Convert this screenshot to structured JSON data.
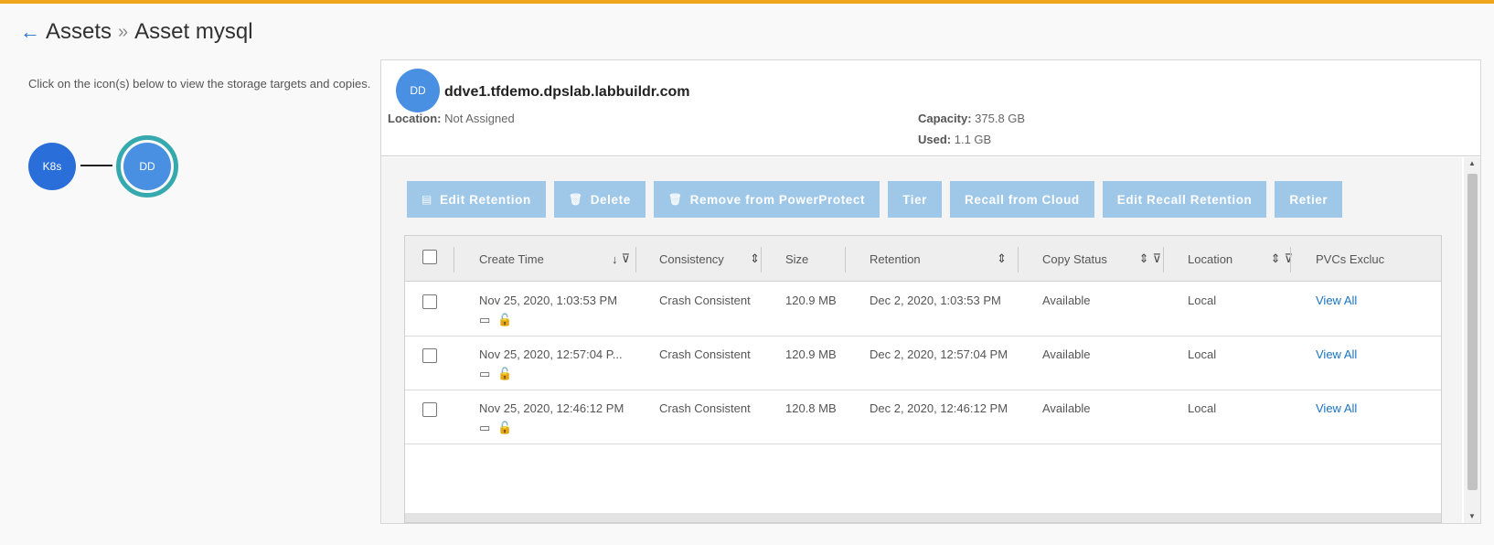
{
  "breadcrumb": {
    "back_icon": "←",
    "root": "Assets",
    "separator": "»",
    "current": "Asset mysql"
  },
  "hint": "Click on the icon(s) below to view the storage targets and copies.",
  "topology": {
    "source": "K8s",
    "target": "DD"
  },
  "target": {
    "avatar": "DD",
    "name": "ddve1.tfdemo.dpslab.labbuildr.com",
    "location_label": "Location:",
    "location_value": "Not Assigned",
    "capacity_label": "Capacity:",
    "capacity_value": "375.8 GB",
    "used_label": "Used:",
    "used_value": "1.1 GB"
  },
  "toolbar": {
    "edit_retention": "Edit Retention",
    "delete": "Delete",
    "remove": "Remove from PowerProtect",
    "tier": "Tier",
    "recall": "Recall from Cloud",
    "edit_recall": "Edit Recall Retention",
    "retier": "Retier"
  },
  "columns": {
    "create_time": "Create Time",
    "consistency": "Consistency",
    "size": "Size",
    "retention": "Retention",
    "copy_status": "Copy Status",
    "location": "Location",
    "pvcs": "PVCs Excluc"
  },
  "rows": [
    {
      "create_time": "Nov 25, 2020, 1:03:53 PM",
      "consistency": "Crash Consistent",
      "size": "120.9 MB",
      "retention": "Dec 2, 2020, 1:03:53 PM",
      "status": "Available",
      "location": "Local",
      "pvcs": "View All"
    },
    {
      "create_time": "Nov 25, 2020, 12:57:04 P...",
      "consistency": "Crash Consistent",
      "size": "120.9 MB",
      "retention": "Dec 2, 2020, 12:57:04 PM",
      "status": "Available",
      "location": "Local",
      "pvcs": "View All"
    },
    {
      "create_time": "Nov 25, 2020, 12:46:12 PM",
      "consistency": "Crash Consistent",
      "size": "120.8 MB",
      "retention": "Dec 2, 2020, 12:46:12 PM",
      "status": "Available",
      "location": "Local",
      "pvcs": "View All"
    }
  ],
  "icons": {
    "sort_down": "↓",
    "sort_both": "⇕",
    "filter": "⊽",
    "folder": "▭",
    "lock": "🔓",
    "calendar": "▤",
    "trash": "🗑"
  },
  "colors": {
    "accent_bar": "#efa51c",
    "link": "#1a73c4",
    "button": "#9fc7e8",
    "k8s_node": "#2a6fd9",
    "dd_node": "#4a90e2",
    "selected_ring": "#35a9ad"
  }
}
